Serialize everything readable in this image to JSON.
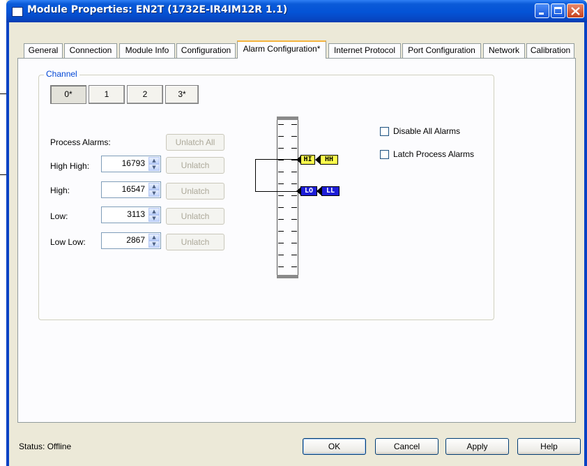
{
  "window": {
    "title": "Module Properties: EN2T (1732E-IR4IM12R 1.1)"
  },
  "tabs": [
    {
      "label": "General"
    },
    {
      "label": "Connection"
    },
    {
      "label": "Module Info"
    },
    {
      "label": "Configuration"
    },
    {
      "label": "Alarm Configuration*",
      "active": true
    },
    {
      "label": "Internet Protocol"
    },
    {
      "label": "Port Configuration"
    },
    {
      "label": "Network"
    },
    {
      "label": "Calibration"
    }
  ],
  "channel": {
    "group_label": "Channel",
    "buttons": [
      "0*",
      "1",
      "2",
      "3*"
    ],
    "selected": "0*"
  },
  "process_alarms": {
    "heading": "Process Alarms:",
    "unlatch_all_label": "Unlatch All",
    "unlatch_label": "Unlatch",
    "rows": [
      {
        "label": "High High:",
        "value": "16793"
      },
      {
        "label": "High:",
        "value": "16547"
      },
      {
        "label": "Low:",
        "value": "3113"
      },
      {
        "label": "Low Low:",
        "value": "2867"
      }
    ]
  },
  "options": {
    "disable_all_alarms": "Disable All Alarms",
    "latch_process_alarms": "Latch Process Alarms"
  },
  "ladder_tags": {
    "hi": "HI",
    "hh": "HH",
    "lo": "LO",
    "ll": "LL"
  },
  "status": {
    "text": "Status:  Offline"
  },
  "buttons": {
    "ok": "OK",
    "cancel": "Cancel",
    "apply": "Apply",
    "help": "Help"
  },
  "colors": {
    "titlebar": "#0453d6",
    "tab_highlight": "#f4b33e",
    "hi_tag": "#ffff4d",
    "lo_tag": "#1e1ed8",
    "group_label": "#0046d5"
  }
}
